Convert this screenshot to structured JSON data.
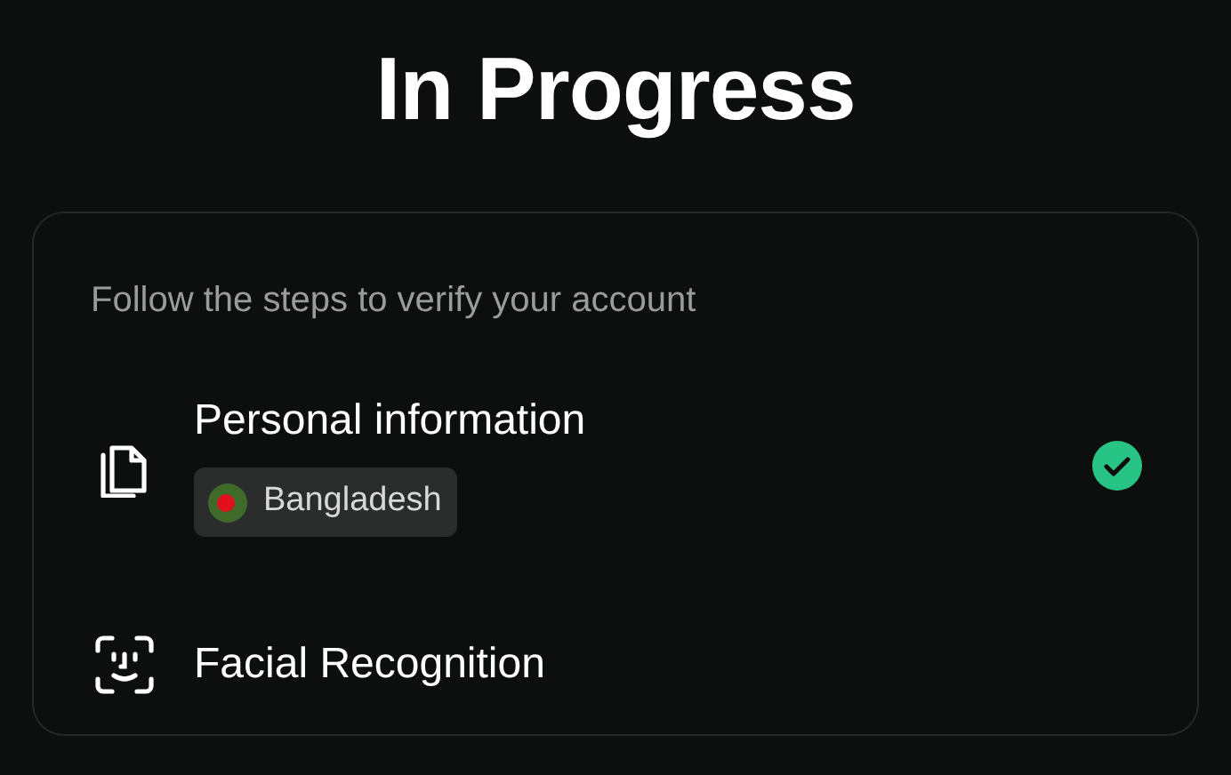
{
  "title": "In Progress",
  "card": {
    "subtitle": "Follow the steps to verify your account",
    "steps": [
      {
        "kind": "document",
        "title": "Personal information",
        "tag": "Bangladesh",
        "completed": true
      },
      {
        "kind": "face",
        "title": "Facial Recognition",
        "completed": false
      }
    ]
  }
}
